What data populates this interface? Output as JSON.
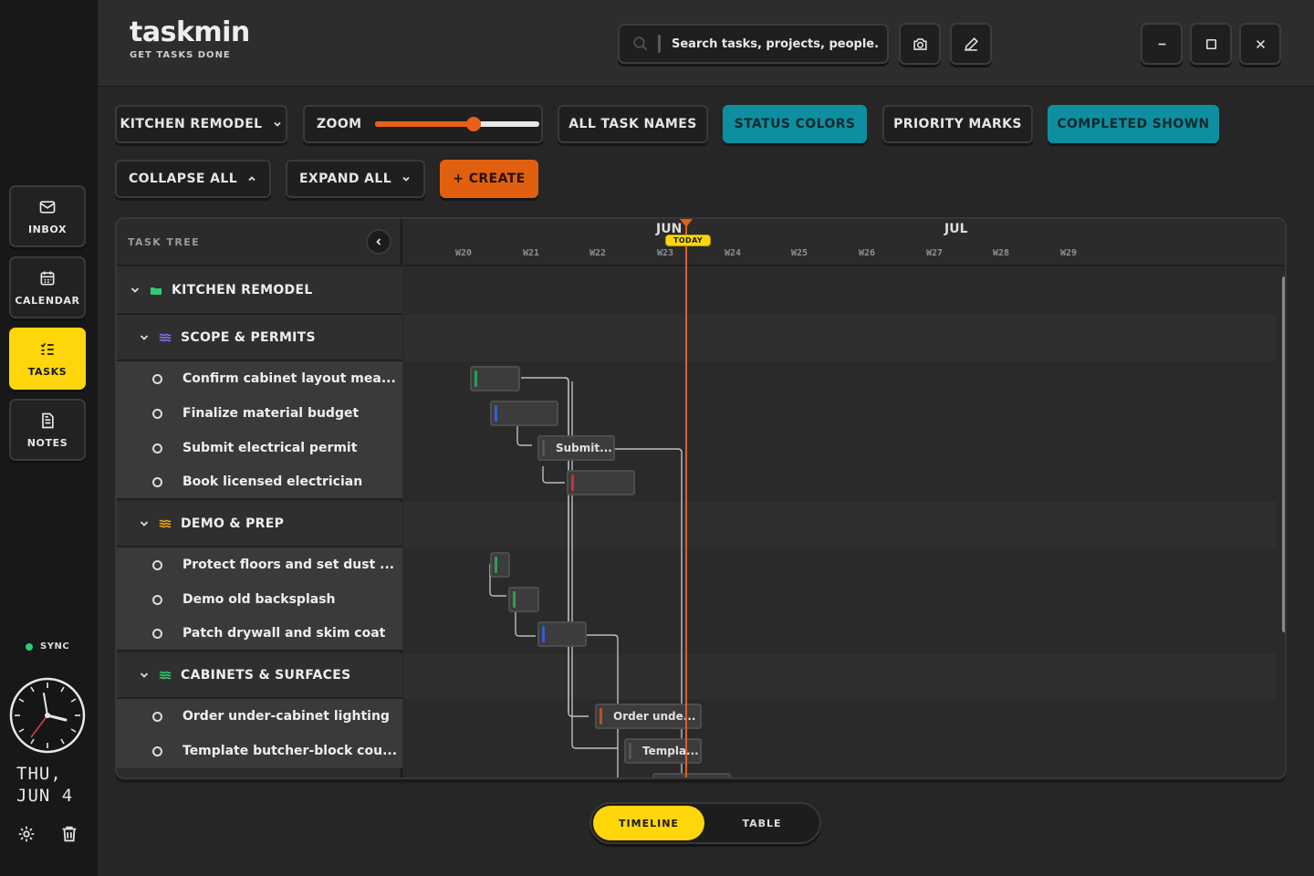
{
  "app": {
    "name": "taskmin",
    "tagline": "GET TASKS DONE"
  },
  "search": {
    "placeholder": "Search tasks, projects, people..."
  },
  "nav": [
    {
      "label": "INBOX",
      "icon": "mail-icon",
      "active": false
    },
    {
      "label": "CALENDAR",
      "icon": "calendar-icon",
      "active": false
    },
    {
      "label": "TASKS",
      "icon": "task-list-icon",
      "active": true
    },
    {
      "label": "NOTES",
      "icon": "notes-icon",
      "active": false
    }
  ],
  "sync": {
    "label": "SYNC",
    "color": "#2ecc71"
  },
  "date": {
    "line1": "THU,",
    "line2": "JUN 4"
  },
  "toolbar": {
    "project": "KITCHEN REMODEL",
    "zoom_label": "ZOOM",
    "zoom_level": 0.6,
    "all_task_names": "ALL TASK NAMES",
    "status_colors": "STATUS COLORS",
    "priority_marks": "PRIORITY MARKS",
    "completed_shown": "COMPLETED SHOWN",
    "collapse_all": "COLLAPSE ALL",
    "expand_all": "EXPAND ALL",
    "create": "+ CREATE"
  },
  "tree": {
    "header": "TASK TREE",
    "project": "KITCHEN REMODEL",
    "groups": [
      {
        "name": "SCOPE & PERMITS",
        "color": "#8a6cf0",
        "tasks": [
          "Confirm cabinet layout mea...",
          "Finalize material budget",
          "Submit electrical permit",
          "Book licensed electrician"
        ]
      },
      {
        "name": "DEMO & PREP",
        "color": "#f0a020",
        "tasks": [
          "Protect floors and set dust ...",
          "Demo old backsplash",
          "Patch drywall and skim coat"
        ]
      },
      {
        "name": "CABINETS & SURFACES",
        "color": "#2ecc71",
        "tasks": [
          "Order under-cabinet lighting",
          "Template butcher-block cou..."
        ]
      }
    ]
  },
  "timeline": {
    "months": [
      "JUN",
      "JUL"
    ],
    "weeks": [
      "W20",
      "W21",
      "W22",
      "W23",
      "W24",
      "W25",
      "W26",
      "W27",
      "W28",
      "W29"
    ],
    "today_label": "TODAY",
    "bars": [
      {
        "label": "",
        "status_color": "#2e9e4e"
      },
      {
        "label": "",
        "status_color": "#2f5fd0"
      },
      {
        "label": "Submit...",
        "status_color": "#555555"
      },
      {
        "label": "",
        "status_color": "#d03030"
      },
      {
        "label": "",
        "status_color": "#2e9e4e"
      },
      {
        "label": "",
        "status_color": "#2e9e4e"
      },
      {
        "label": "",
        "status_color": "#2f5fd0"
      },
      {
        "label": "Order unde...",
        "status_color": "#c0501a"
      },
      {
        "label": "Templa...",
        "status_color": "#555555"
      }
    ]
  },
  "view": {
    "timeline": "TIMELINE",
    "table": "TABLE"
  }
}
